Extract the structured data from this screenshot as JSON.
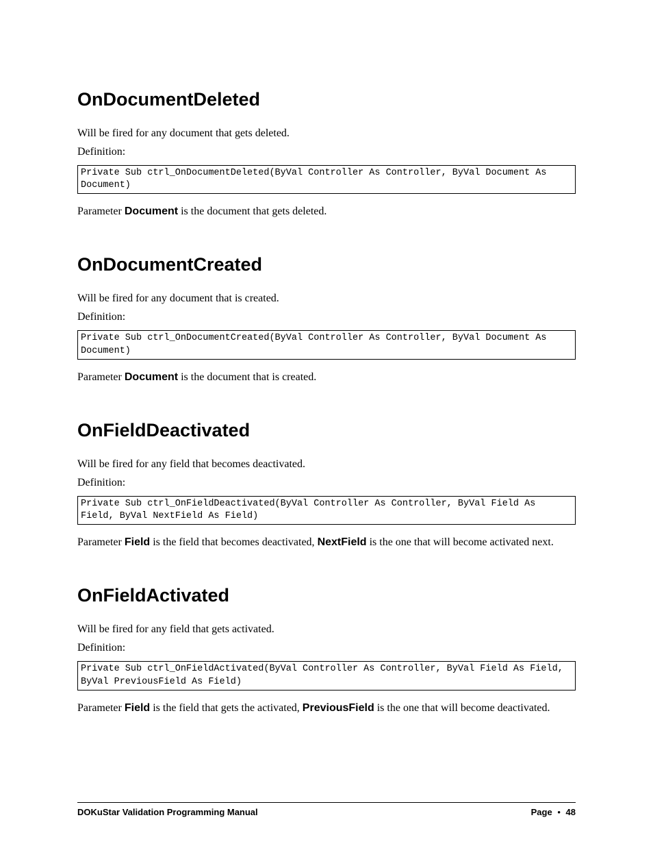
{
  "sections": [
    {
      "heading": "OnDocumentDeleted",
      "intro": "Will be fired for any document that gets deleted.",
      "def_label": "Definition:",
      "code": "Private Sub ctrl_OnDocumentDeleted(ByVal Controller As Controller, ByVal Document As Document)",
      "param_pre": "Parameter ",
      "param_bold1": "Document",
      "param_mid": " is the document that gets deleted.",
      "param_bold2": "",
      "param_post": ""
    },
    {
      "heading": "OnDocumentCreated",
      "intro": "Will be fired for any document that is created.",
      "def_label": "Definition:",
      "code": "Private Sub ctrl_OnDocumentCreated(ByVal Controller As Controller, ByVal Document As Document)",
      "param_pre": "Parameter ",
      "param_bold1": "Document",
      "param_mid": " is the document that is created.",
      "param_bold2": "",
      "param_post": ""
    },
    {
      "heading": "OnFieldDeactivated",
      "intro": "Will be fired for any field that becomes deactivated.",
      "def_label": "Definition:",
      "code": "Private Sub ctrl_OnFieldDeactivated(ByVal Controller As Controller, ByVal Field As Field, ByVal NextField As Field)",
      "param_pre": "Parameter ",
      "param_bold1": "Field",
      "param_mid": " is the field that becomes deactivated, ",
      "param_bold2": "NextField",
      "param_post": " is the one that will become activated next."
    },
    {
      "heading": "OnFieldActivated",
      "intro": "Will be fired for any field that gets activated.",
      "def_label": "Definition:",
      "code": "Private Sub ctrl_OnFieldActivated(ByVal Controller As Controller, ByVal Field As Field, ByVal PreviousField As Field)",
      "param_pre": "Parameter ",
      "param_bold1": "Field",
      "param_mid": " is the field that gets the activated, ",
      "param_bold2": "PreviousField",
      "param_post": " is the one that will become deactivated."
    }
  ],
  "footer": {
    "left": "DOKuStar Validation Programming Manual",
    "right_label": "Page",
    "bullet": "•",
    "page_no": "48"
  }
}
